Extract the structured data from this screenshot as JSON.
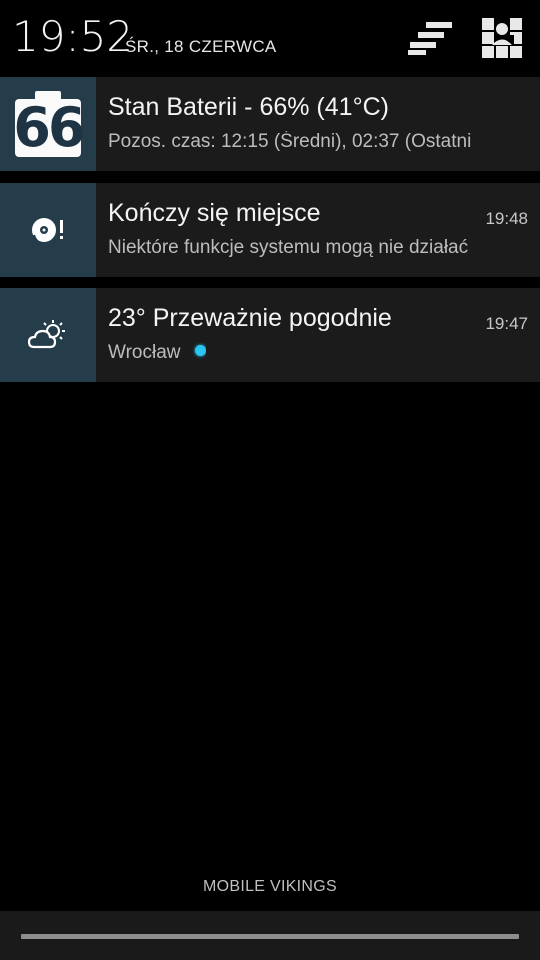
{
  "header": {
    "clock": "19:52",
    "date": "ŚR., 18 CZERWCA",
    "clear_icon": "clear-all-icon",
    "settings_icon": "quick-settings-icon"
  },
  "notifications": [
    {
      "icon": "battery-66-icon",
      "icon_text": "66",
      "title": "Stan Baterii - 66% (41°C)",
      "text": "Pozos. czas: 12:15 (Średni), 02:37 (Ostatni",
      "time": ""
    },
    {
      "icon": "storage-warning-icon",
      "title": "Kończy się miejsce",
      "text": "Niektóre funkcje systemu mogą nie działać",
      "time": "19:48"
    },
    {
      "icon": "weather-partly-cloudy-icon",
      "title": "23° Przeważnie pogodnie",
      "text": "Wrocław",
      "time": "19:47",
      "dot_color": "#29c6f0"
    }
  ],
  "carrier": "MOBILE VIKINGS",
  "colors": {
    "background": "#000000",
    "notification_bg": "#1b1b1b",
    "icon_bg": "#253c4a",
    "accent_dot": "#29c6f0"
  }
}
